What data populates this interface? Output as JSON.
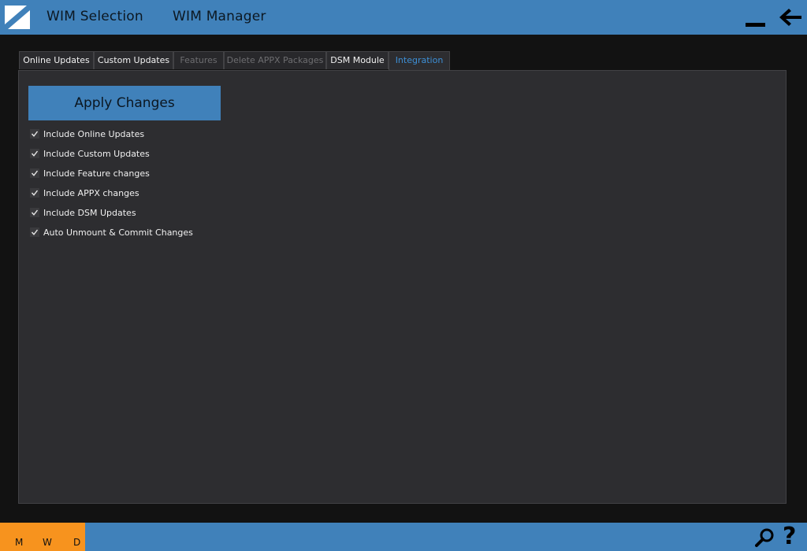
{
  "header": {
    "nav": [
      "WIM Selection",
      "WIM Manager"
    ]
  },
  "tabs": [
    {
      "label": "Online Updates",
      "state": "normal"
    },
    {
      "label": "Custom Updates",
      "state": "normal"
    },
    {
      "label": "Features",
      "state": "disabled"
    },
    {
      "label": "Delete APPX Packages",
      "state": "disabled"
    },
    {
      "label": "DSM Module",
      "state": "normal"
    },
    {
      "label": "Integration",
      "state": "active"
    }
  ],
  "main": {
    "apply_label": "Apply Changes",
    "options": [
      {
        "label": "Include Online Updates",
        "checked": true
      },
      {
        "label": "Include Custom Updates",
        "checked": true
      },
      {
        "label": "Include Feature changes",
        "checked": true
      },
      {
        "label": "Include APPX changes",
        "checked": true
      },
      {
        "label": "Include DSM Updates",
        "checked": true
      },
      {
        "label": "Auto Unmount & Commit Changes",
        "checked": true
      }
    ]
  },
  "footer": {
    "mwd": [
      "M",
      "W",
      "D"
    ],
    "help_label": "?"
  },
  "colors": {
    "accent": "#4081ba",
    "active_tab": "#3d8fd6",
    "mwd": "#f7931e",
    "background": "#121212",
    "panel": "#2d2d30"
  },
  "icons": {
    "logo": "app-logo-icon",
    "minimize": "minimize-icon",
    "back": "back-arrow-icon",
    "search": "search-icon",
    "help": "help-icon",
    "check": "checkmark-icon"
  }
}
